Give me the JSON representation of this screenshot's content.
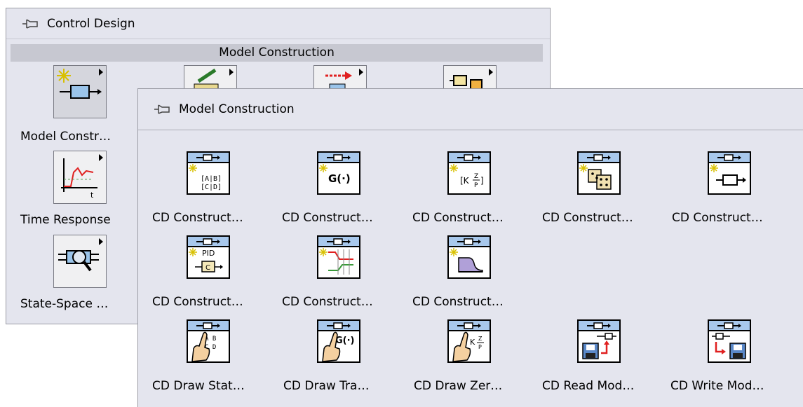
{
  "back_palette": {
    "title": "Control Design",
    "section": "Model Construction",
    "items": [
      {
        "label": "Model Constr…",
        "icon": "model-construction-icon"
      },
      {
        "label": "Time Response",
        "icon": "time-response-icon"
      },
      {
        "label": "State-Space …",
        "icon": "state-space-icon"
      }
    ],
    "stub_icons": [
      "model-edit-icon",
      "model-conversion-icon",
      "model-interconnection-icon"
    ]
  },
  "front_palette": {
    "title": "Model Construction",
    "rows": [
      [
        {
          "label": "CD Construct…",
          "icon": "construct-state-space-icon"
        },
        {
          "label": "CD Construct…",
          "icon": "construct-transfer-function-icon"
        },
        {
          "label": "CD Construct…",
          "icon": "construct-zpk-icon"
        },
        {
          "label": "CD Construct…",
          "icon": "construct-random-model-icon"
        },
        {
          "label": "CD Construct…",
          "icon": "construct-special-model-icon"
        }
      ],
      [
        {
          "label": "CD Construct…",
          "icon": "construct-pid-icon"
        },
        {
          "label": "CD Construct…",
          "icon": "construct-filter-icon"
        },
        {
          "label": "CD Construct…",
          "icon": "construct-delay-icon"
        }
      ],
      [
        {
          "label": "CD Draw Stat…",
          "icon": "draw-state-space-icon"
        },
        {
          "label": "CD Draw Tra…",
          "icon": "draw-transfer-function-icon"
        },
        {
          "label": "CD Draw Zer…",
          "icon": "draw-zpk-icon"
        },
        {
          "label": "CD Read Mod…",
          "icon": "read-model-icon"
        },
        {
          "label": "CD Write Mod…",
          "icon": "write-model-icon"
        }
      ]
    ]
  },
  "colors": {
    "palette_bg": "#e4e5ee",
    "section_bar": "#c7c8d1",
    "vi_header": "#a8c8ec",
    "accent_red": "#e02020",
    "accent_yellow": "#f4e000"
  }
}
